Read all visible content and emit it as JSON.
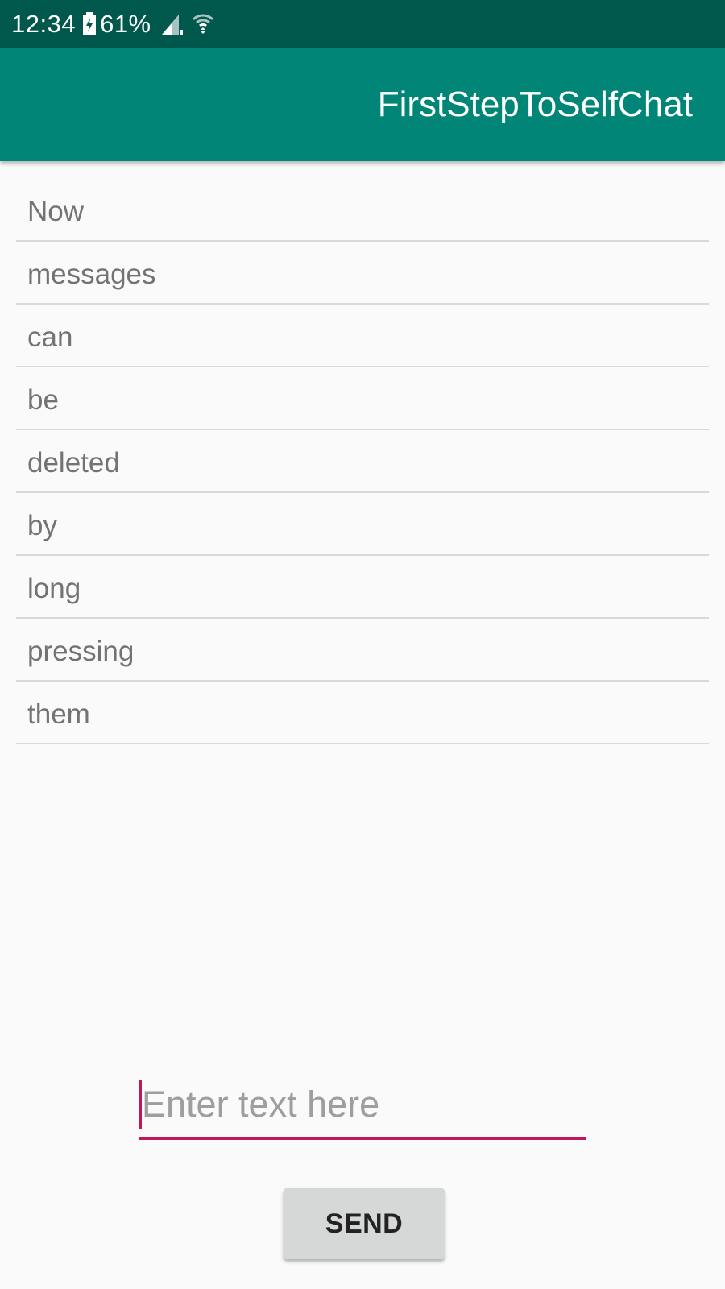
{
  "status_bar": {
    "time": "12:34",
    "battery_percent": "61%",
    "icons": [
      "battery-charging-icon",
      "signal-icon",
      "wifi-icon"
    ]
  },
  "app_bar": {
    "title": "FirstStepToSelfChat",
    "color": "#008577"
  },
  "messages": [
    "Now",
    "messages",
    "can",
    "be",
    "deleted",
    "by",
    "long",
    "pressing",
    "them"
  ],
  "composer": {
    "placeholder": "Enter text here",
    "value": "",
    "send_label": "SEND",
    "accent_color": "#c2185b"
  }
}
